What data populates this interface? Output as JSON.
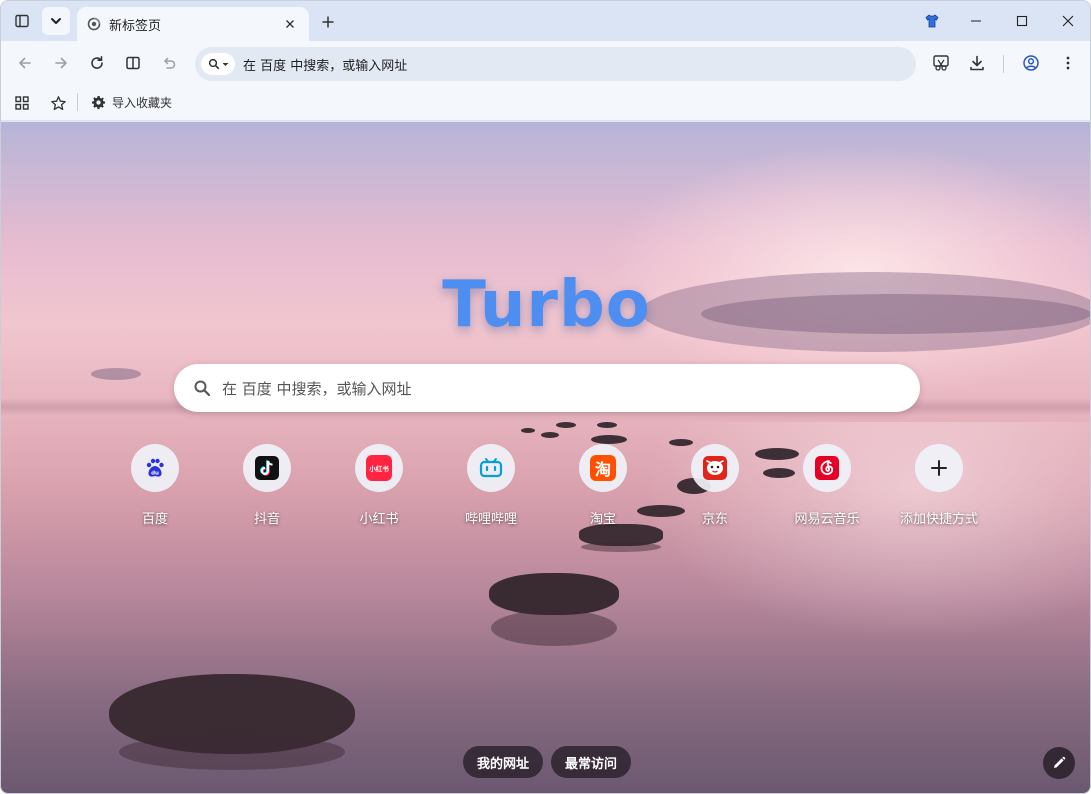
{
  "tab": {
    "title": "新标签页"
  },
  "omnibox": {
    "placeholder": "在 百度 中搜索，或输入网址"
  },
  "bookmarks": {
    "import_label": "导入收藏夹"
  },
  "logo": {
    "text": "Turbo"
  },
  "search": {
    "placeholder": "在 百度 中搜索，或输入网址"
  },
  "shortcuts": [
    {
      "label": "百度",
      "icon": "baidu-icon"
    },
    {
      "label": "抖音",
      "icon": "douyin-icon"
    },
    {
      "label": "小红书",
      "icon": "xiaohongshu-icon"
    },
    {
      "label": "哔哩哔哩",
      "icon": "bilibili-icon"
    },
    {
      "label": "淘宝",
      "icon": "taobao-icon"
    },
    {
      "label": "京东",
      "icon": "jd-icon"
    },
    {
      "label": "网易云音乐",
      "icon": "netease-music-icon"
    },
    {
      "label": "添加快捷方式",
      "icon": "plus-icon"
    }
  ],
  "tile_glyphs": {
    "xiaohongshu": "小红书",
    "taobao": "淘"
  },
  "bottom": {
    "my_sites": "我的网址",
    "most_visited": "最常访问"
  },
  "colors": {
    "logo": "#4e8ef0",
    "tab_strip": "#dbe4f4",
    "toolbar": "#f4f7fc"
  }
}
